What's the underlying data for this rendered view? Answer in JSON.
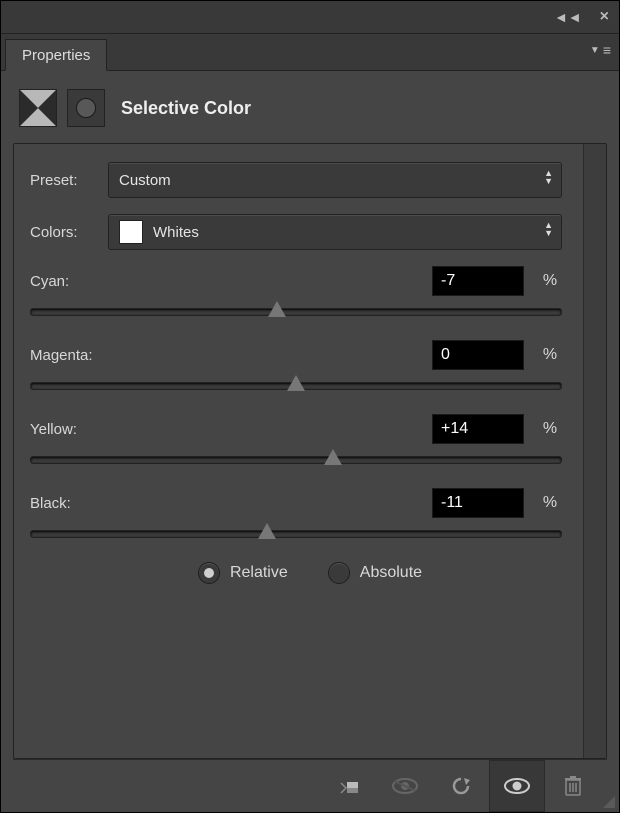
{
  "tab": {
    "label": "Properties"
  },
  "title": "Selective Color",
  "preset": {
    "label": "Preset:",
    "value": "Custom"
  },
  "colors": {
    "label": "Colors:",
    "value": "Whites",
    "swatch": "#ffffff"
  },
  "sliders": {
    "cyan": {
      "label": "Cyan:",
      "value": "-7",
      "unit": "%",
      "pos": 46.5
    },
    "magenta": {
      "label": "Magenta:",
      "value": "0",
      "unit": "%",
      "pos": 50
    },
    "yellow": {
      "label": "Yellow:",
      "value": "+14",
      "unit": "%",
      "pos": 57
    },
    "black": {
      "label": "Black:",
      "value": "-11",
      "unit": "%",
      "pos": 44.5
    }
  },
  "mode": {
    "relative": {
      "label": "Relative",
      "checked": true
    },
    "absolute": {
      "label": "Absolute",
      "checked": false
    }
  }
}
